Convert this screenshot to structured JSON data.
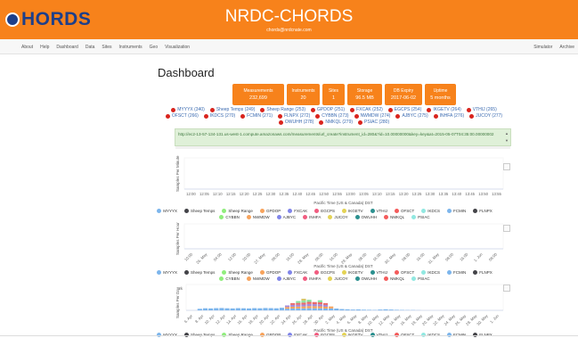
{
  "header": {
    "logo_text": "HORDS",
    "title": "NRDC-CHORDS",
    "email": "chords@nrdcnate.com",
    "brand_color": "#f7821b",
    "logo_color": "#1d3f8a"
  },
  "nav": {
    "left": [
      "About",
      "Help",
      "Dashboard",
      "Data",
      "Sites",
      "Instruments",
      "Geo",
      "Visualization"
    ],
    "right": [
      "Simulator",
      "Archive"
    ]
  },
  "main": {
    "heading": "Dashboard",
    "stats": [
      {
        "label": "Measurements",
        "value": "232,699"
      },
      {
        "label": "Instruments",
        "value": "20"
      },
      {
        "label": "Sites",
        "value": "1"
      },
      {
        "label": "Storage",
        "value": "96.5 MB"
      },
      {
        "label": "DB Expiry",
        "value": "2017-06-02"
      },
      {
        "label": "Uptime",
        "value": "5 months"
      }
    ],
    "instruments": [
      "MYYYX (340)",
      "Sheep Temps (249)",
      "Sheep Range (253)",
      "GPDOP (251)",
      "FXCAK (252)",
      "EGCPS (254)",
      "IKGETV (264)",
      "VTHIJ (265)",
      "OFSCT (266)",
      "IKDCS (270)",
      "FCMIN (271)",
      "FLNPX (272)",
      "CYBBN (273)",
      "NWMDW (274)",
      "AJBYC (275)",
      "INHFA (276)",
      "JUCOY (277)",
      "OWUHH (278)",
      "NMKQL (279)",
      "PSIAC (280)"
    ],
    "url_text": "http://ec2-13-57-134-131.us-west-1.compute.amazonaws.com/measurements/url_create?instrument_id=280&?id=10.00000000&key=key&at=2015-05-07T04:35:00.00000002",
    "instrument_dot_color": "#d9241d"
  },
  "charts": {
    "chart1": {
      "ylabel": "Samples Per Minute",
      "xtitle": "Pacific Time (US & Canada) DST",
      "ticks": [
        "12:00",
        "12:05",
        "12:10",
        "12:15",
        "12:20",
        "12:25",
        "12:30",
        "12:35",
        "12:40",
        "12:45",
        "12:50",
        "12:55",
        "13:00",
        "13:05",
        "13:10",
        "13:15",
        "13:20",
        "13:25",
        "13:30",
        "13:35",
        "13:40",
        "13:45",
        "13:50",
        "13:55"
      ]
    },
    "chart2": {
      "ylabel": "Samples Per Hour",
      "xtitle": "Pacific Time (US & Canada) DST",
      "ticks": [
        "10:00",
        "26. May",
        "04:00",
        "12:00",
        "20:00",
        "27. May",
        "08:00",
        "16:00",
        "28. May",
        "08:00",
        "16:00",
        "29. May",
        "08:00",
        "16:00",
        "30. May",
        "08:00",
        "16:00",
        "31. May",
        "08:00",
        "16:00",
        "1. Jun",
        "08:00"
      ]
    },
    "chart3": {
      "ylabel": "Samples Per Day",
      "xtitle": "Pacific Time (US & Canada) DST",
      "ytick": "2k",
      "ticks": [
        "6. Apr",
        "8. Apr",
        "10. Apr",
        "12. Apr",
        "14. Apr",
        "16. Apr",
        "18. Apr",
        "20. Apr",
        "22. Apr",
        "24. Apr",
        "26. Apr",
        "28. Apr",
        "30. Apr",
        "2. May",
        "4. May",
        "6. May",
        "8. May",
        "10. May",
        "12. May",
        "14. May",
        "16. May",
        "18. May",
        "20. May",
        "22. May",
        "24. May",
        "26. May",
        "28. May",
        "30. May",
        "1. Jun"
      ],
      "day_totals": [
        0,
        0,
        120,
        160,
        150,
        170,
        180,
        160,
        150,
        170,
        160,
        150,
        170,
        160,
        180,
        170,
        160,
        200,
        380,
        560,
        720,
        900,
        820,
        640,
        780,
        560,
        300,
        140,
        100,
        80,
        60,
        70,
        50,
        40,
        30,
        60,
        80,
        60,
        40,
        30,
        20,
        20,
        10,
        0,
        0,
        0,
        0,
        0,
        0,
        0,
        0,
        0,
        0,
        0,
        0,
        0,
        0,
        0
      ],
      "stack_colors": [
        "#7cb5ec",
        "#f7a35c",
        "#a68bd8",
        "#e86b6b",
        "#8be2a1",
        "#d6c66a"
      ]
    }
  },
  "legend_items": [
    {
      "name": "MYYYX",
      "color": "#7cb5ec"
    },
    {
      "name": "Sheep Temps",
      "color": "#434348"
    },
    {
      "name": "Sheep Range",
      "color": "#90ed7d"
    },
    {
      "name": "GPDOP",
      "color": "#f7a35c"
    },
    {
      "name": "FXCAK",
      "color": "#8085e9"
    },
    {
      "name": "EGCPS",
      "color": "#f15c80"
    },
    {
      "name": "IKGETV",
      "color": "#e4d354"
    },
    {
      "name": "VTHIJ",
      "color": "#2b908f"
    },
    {
      "name": "OFSCT",
      "color": "#f45b5b"
    },
    {
      "name": "IKDCS",
      "color": "#91e8e1"
    },
    {
      "name": "FCMIN",
      "color": "#7cb5ec"
    },
    {
      "name": "FLNPX",
      "color": "#434348"
    },
    {
      "name": "CYBBN",
      "color": "#90ed7d"
    },
    {
      "name": "NWMDW",
      "color": "#f7a35c"
    },
    {
      "name": "AJBYC",
      "color": "#8085e9"
    },
    {
      "name": "INHFA",
      "color": "#f15c80"
    },
    {
      "name": "JUCOY",
      "color": "#e4d354"
    },
    {
      "name": "OWUHH",
      "color": "#2b908f"
    },
    {
      "name": "NMKQL",
      "color": "#f45b5b"
    },
    {
      "name": "PSIAC",
      "color": "#91e8e1"
    }
  ],
  "legend3_count": 12
}
